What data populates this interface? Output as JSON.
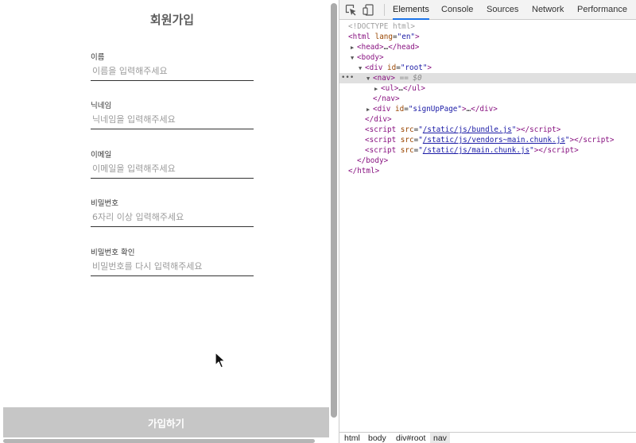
{
  "page": {
    "title": "회원가입",
    "fields": [
      {
        "label": "이름",
        "placeholder": "이름을 입력해주세요",
        "value": ""
      },
      {
        "label": "닉네임",
        "placeholder": "닉네임을 입력해주세요",
        "value": ""
      },
      {
        "label": "이메일",
        "placeholder": "이메일을 입력해주세요",
        "value": ""
      },
      {
        "label": "비밀번호",
        "placeholder": "6자리 이상 입력해주세요",
        "value": ""
      },
      {
        "label": "비밀번호 확인",
        "placeholder": "비밀번호를 다시 입력해주세요",
        "value": ""
      }
    ],
    "submit_label": "가입하기"
  },
  "devtools": {
    "tabs": [
      "Elements",
      "Console",
      "Sources",
      "Network",
      "Performance"
    ],
    "active_tab": "Elements",
    "icons": [
      "inspect-element-icon",
      "device-toolbar-icon"
    ],
    "tree": {
      "doctype": "<!DOCTYPE html>",
      "html_tag": "html",
      "html_attr": "lang",
      "html_val": "en",
      "head_collapsed": "…",
      "root_attr": "id",
      "root_val": "root",
      "selected_marker": "== $0",
      "ul_collapsed": "…",
      "signup_val": "signUpPage",
      "script_attr": "src",
      "scripts": [
        "/static/js/bundle.js",
        "/static/js/vendors~main.chunk.js",
        "/static/js/main.chunk.js"
      ]
    },
    "breadcrumbs": [
      "html",
      "body",
      "div#root",
      "nav"
    ]
  }
}
